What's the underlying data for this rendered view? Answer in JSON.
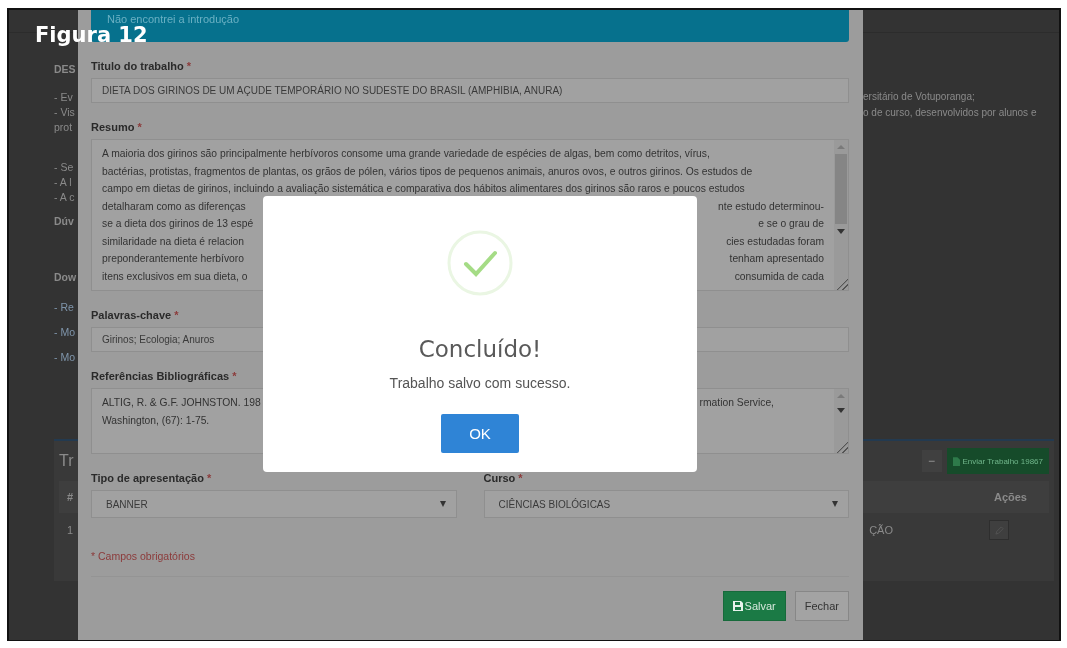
{
  "figure_label": "Figura 12",
  "background_page": {
    "left_groups": [
      [
        "DES"
      ],
      [
        "- Ev",
        "- Vis",
        "prot"
      ],
      [
        "- Se",
        "- A l",
        "- A c"
      ],
      [
        "Dúv"
      ],
      [
        "Dow"
      ],
      [
        "- Re",
        "- Mo",
        "- Mo"
      ]
    ],
    "right_lines": [
      "ersitário de Votuporanga;",
      "o de curso, desenvolvidos por alunos e"
    ],
    "table_card": {
      "title": "Tr",
      "collapse_button": "−",
      "send_button": "Enviar Trabalho 19867",
      "columns": [
        "#",
        "Ações"
      ],
      "row": [
        "1",
        "ÇÃO"
      ]
    }
  },
  "form_modal": {
    "alert": "Não encontrei a introdução",
    "fields": [
      {
        "kind": "text",
        "label": "Titulo do trabalho",
        "mark": "*",
        "value": "DIETA DOS GIRINOS DE UM AÇUDE TEMPORÁRIO NO SUDESTE DO BRASIL (AMPHIBIA, ANURA)"
      },
      {
        "kind": "textarea",
        "label": "Resumo",
        "mark": "*",
        "lines": [
          {
            "left": "A maioria dos girinos são principalmente herbívoros consome uma grande variedade de espécies de algas, bem como detritos, vírus,"
          },
          {
            "left": "bactérias, protistas, fragmentos de plantas, os grãos de pólen, vários tipos de pequenos animais, anuros ovos, e outros girinos. Os estudos de"
          },
          {
            "left": "campo em dietas de girinos, incluindo a avaliação sistemática e comparativa dos hábitos alimentares dos girinos são raros e poucos estudos"
          },
          {
            "left": "detalharam como as diferenças",
            "right": "nte estudo determinou-"
          },
          {
            "left": "se a dieta dos girinos de 13 espé",
            "right": "e se o grau de"
          },
          {
            "left": "similaridade na dieta é relacion",
            "right": "cies estudadas foram"
          },
          {
            "left": "preponderantemente herbívoro",
            "right": "tenham apresentado"
          },
          {
            "left": "itens exclusivos em sua dieta, o",
            "right": "consumida de cada"
          }
        ]
      },
      {
        "kind": "text",
        "label": "Palavras-chave",
        "mark": "*",
        "value": "Girinos; Ecologia; Anuros"
      },
      {
        "kind": "textarea",
        "label": "Referências Bibliográficas",
        "mark": "*",
        "lines": [
          {
            "left": "ALTIG, R. & G.F. JOHNSTON. 198",
            "right": "rmation Service,"
          },
          {
            "left": "Washington, (67): 1-75."
          }
        ]
      }
    ],
    "selects": [
      {
        "label": "Tipo de apresentação",
        "mark": "*",
        "value": "BANNER"
      },
      {
        "label": "Curso",
        "mark": "*",
        "value": "CIÊNCIAS BIOLÓGICAS"
      }
    ],
    "required_note": "* Campos obrigatórios",
    "buttons": [
      {
        "kind": "primary",
        "label": "Salvar"
      },
      {
        "kind": "default",
        "label": "Fechar"
      }
    ]
  },
  "success_dialog": {
    "title": "Concluído!",
    "message": "Trabalho salvo com sucesso.",
    "button": "OK"
  }
}
